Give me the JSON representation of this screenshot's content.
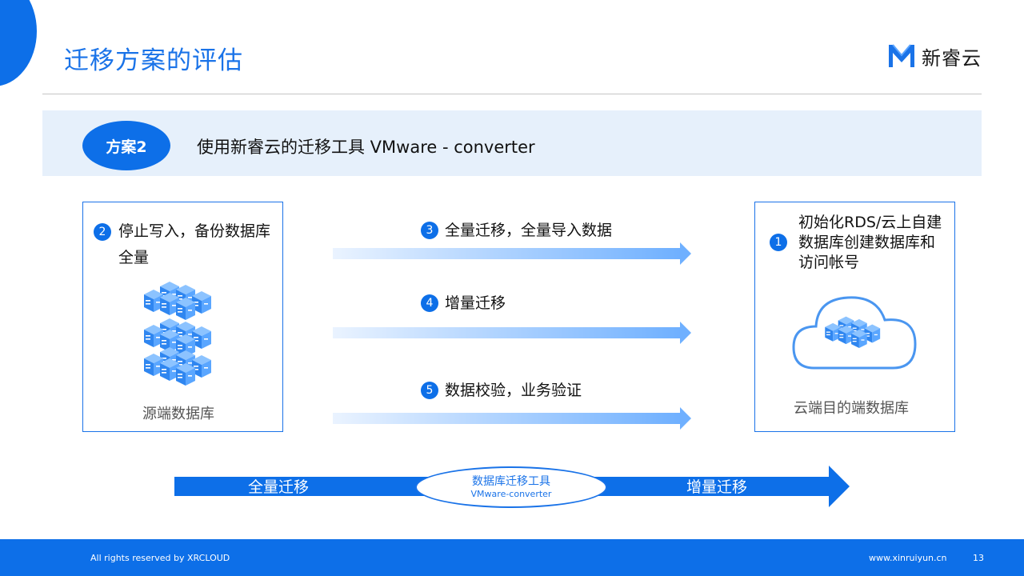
{
  "slide": {
    "title": "迁移方案的评估",
    "page_number": "13"
  },
  "logo": {
    "icon": "xinruiyun-logo-icon",
    "name": "新睿云"
  },
  "plan": {
    "badge": "方案2",
    "description": "使用新睿云的迁移工具 VMware - converter"
  },
  "source": {
    "step_number": "2",
    "step_line1": "停止写入，备份数据库",
    "step_line2": "全量",
    "icon": "server-cluster-icon",
    "caption": "源端数据库"
  },
  "target": {
    "step_number": "1",
    "step_line1": "初始化RDS/云上自建",
    "step_line2": "数据库创建数据库和",
    "step_line3": "访问帐号",
    "icon": "cloud-database-icon",
    "caption": "云端目的端数据库"
  },
  "steps": [
    {
      "number": "3",
      "label": "全量迁移，全量导入数据"
    },
    {
      "number": "4",
      "label": "增量迁移"
    },
    {
      "number": "5",
      "label": "数据校验，业务验证"
    }
  ],
  "timeline": {
    "left_label": "全量迁移",
    "center_line1": "数据库迁移工具",
    "center_line2": "VMware-converter",
    "right_label": "增量迁移"
  },
  "footer": {
    "copyright": "All rights reserved by XRCLOUD",
    "website": "www.xinruiyun.cn"
  },
  "colors": {
    "accent": "#0d6fe8",
    "title": "#1a73e8",
    "plan_bar": "#e6f0fb"
  }
}
